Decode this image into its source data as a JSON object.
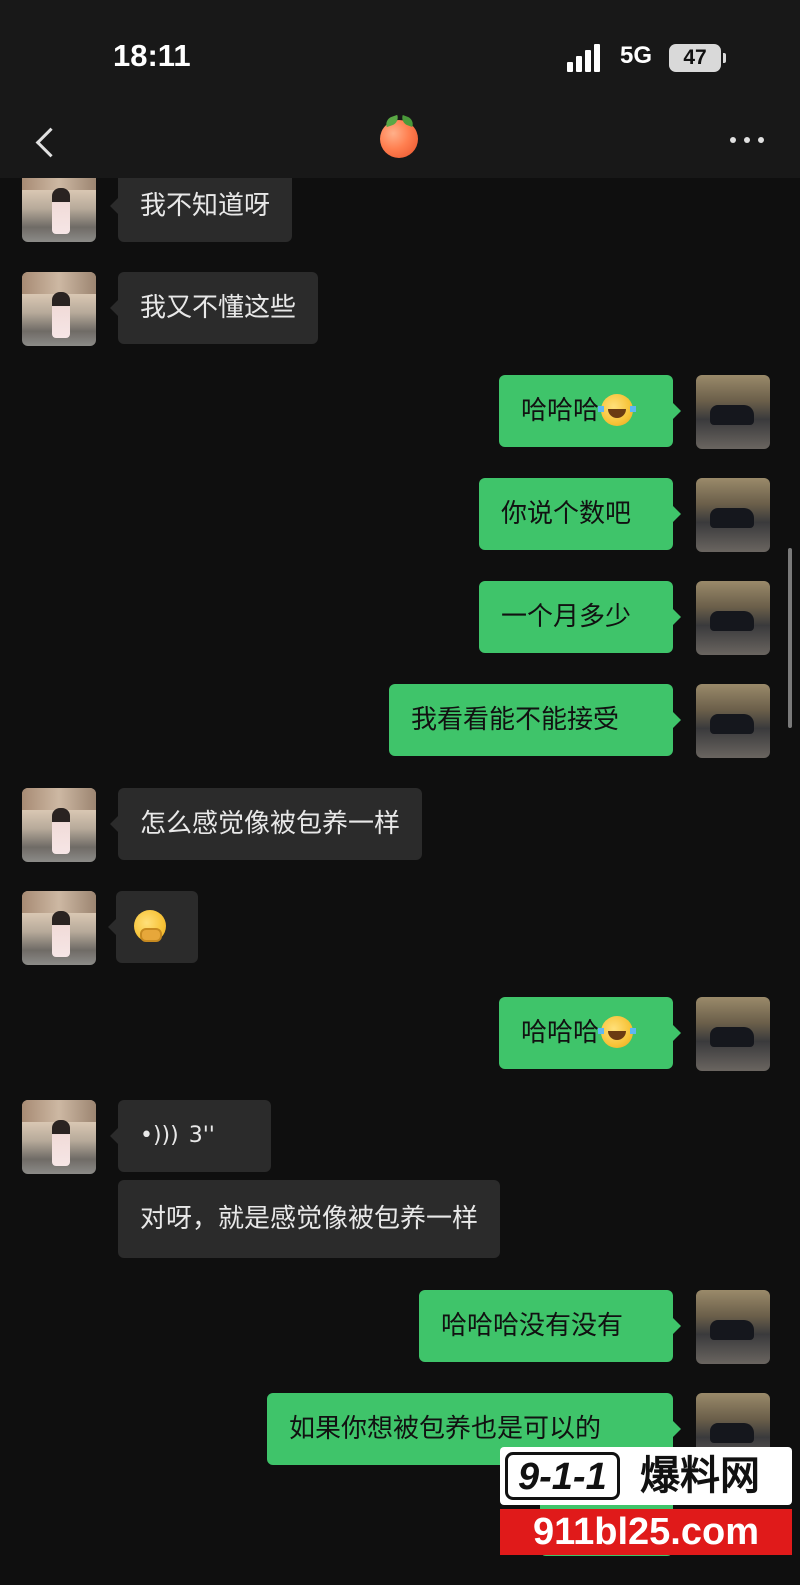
{
  "status_bar": {
    "time": "18:11",
    "network": "5G",
    "battery": "47"
  },
  "nav": {
    "title_icon": "peach-emoji",
    "back_icon": "chevron-left-icon",
    "more_icon": "more-dots-icon"
  },
  "colors": {
    "background": "#0f0f0f",
    "incoming_bubble": "#2b2b2b",
    "outgoing_bubble": "#3fc46a",
    "watermark_red": "#e01a1a"
  },
  "messages": [
    {
      "side": "in",
      "text": "我不知道呀"
    },
    {
      "side": "in",
      "text": "我又不懂这些"
    },
    {
      "side": "out",
      "text": "哈哈哈",
      "emoji": "face-with-tears-of-joy"
    },
    {
      "side": "out",
      "text": "你说个数吧"
    },
    {
      "side": "out",
      "text": "一个月多少"
    },
    {
      "side": "out",
      "text": "我看看能不能接受"
    },
    {
      "side": "in",
      "text": "怎么感觉像被包养一样"
    },
    {
      "side": "in",
      "text": "",
      "emoji": "face-with-hand-over-mouth"
    },
    {
      "side": "out",
      "text": "哈哈哈",
      "emoji": "face-with-tears-of-joy"
    },
    {
      "side": "in",
      "type": "voice",
      "text": "3''"
    },
    {
      "side": "in",
      "type": "transcript",
      "text": "对呀，就是感觉像被包养一样"
    },
    {
      "side": "out",
      "text": "哈哈哈没有没有"
    },
    {
      "side": "out",
      "text": "如果你想被包养也是可以的"
    }
  ],
  "watermark": {
    "logo": "9-1-1",
    "name": "爆料网",
    "url": "911bl25.com"
  }
}
